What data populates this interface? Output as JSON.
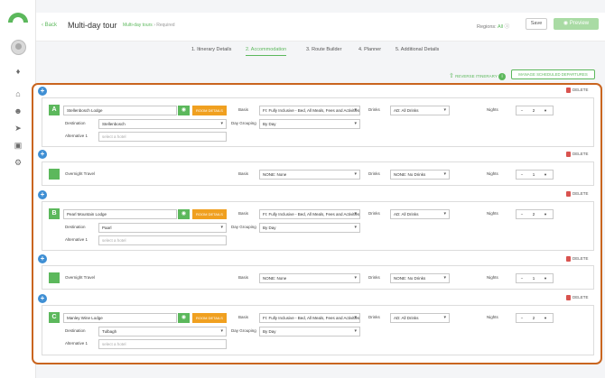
{
  "header": {
    "back": "Back",
    "title": "Multi-day tour",
    "breadcrumb": "Multi-day tours",
    "required": "Required",
    "regions_label": "Regions:",
    "regions_value": "All",
    "save": "Save",
    "preview": "Preview"
  },
  "tabs": [
    "1. Itinerary Details",
    "2. Accommodation",
    "3. Route Builder",
    "4. Planner",
    "5. Additional Details"
  ],
  "actions": {
    "reverse": "REVERSE ITINERARY",
    "manage": "MANAGE SCHEDULED DEPARTURES",
    "delete": "DELETE",
    "room_details": "ROOM DETAILS"
  },
  "labels": {
    "destination": "Destination",
    "alternative": "Alternative 1",
    "basis": "Basis",
    "day_grouping": "Day Grouping",
    "drinks": "Drinks",
    "nights": "Nights"
  },
  "stays": [
    {
      "letter": "A",
      "lodge": "Stellenbosch Lodge",
      "destination": "Stellenbosch",
      "alt_placeholder": "select a hotel",
      "basis": "FI: Fully Inclusive - Bed, All Meals, Fees and Activities",
      "grouping": "By Day",
      "drinks": "AD: All Drinks",
      "nights": "2"
    },
    {
      "letter": "B",
      "lodge": "Pearl Mountain Lodge",
      "destination": "Paarl",
      "alt_placeholder": "select a hotel",
      "basis": "FI: Fully Inclusive - Bed, All Meals, Fees and Activities",
      "grouping": "By Day",
      "drinks": "AD: All Drinks",
      "nights": "2"
    },
    {
      "letter": "C",
      "lodge": "Manley Wine Lodge",
      "destination": "Tulbagh",
      "alt_placeholder": "select a hotel",
      "basis": "FI: Fully Inclusive - Bed, All Meals, Fees and Activities",
      "grouping": "By Day",
      "drinks": "AD: All Drinks",
      "nights": "2"
    }
  ],
  "overnights": [
    {
      "label": "Overnight Travel",
      "basis": "NONE: None",
      "drinks": "NONE: No Drinks",
      "nights": "1"
    },
    {
      "label": "Overnight Travel",
      "basis": "NONE: None",
      "drinks": "NONE: No Drinks",
      "nights": "1"
    }
  ],
  "colors": {
    "accent": "#5cb85c",
    "highlight": "#c9651f",
    "add": "#3f8fd4",
    "room": "#f0a020",
    "delete": "#d9534f"
  }
}
